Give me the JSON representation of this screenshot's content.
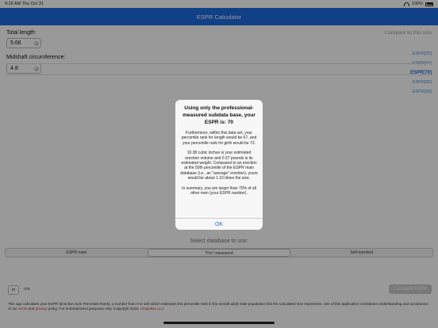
{
  "status": {
    "time": "4:26 AM  Thu Oct 31",
    "battery": "100%"
  },
  "nav": {
    "title": "ESPR Calculator"
  },
  "form": {
    "length_label": "Total length:",
    "length_value": "5.66",
    "girth_label": "Midshaft circumference:",
    "girth_value": "4.8"
  },
  "compare": {
    "label": "Compare to this size",
    "items": [
      "ESPR[25]",
      "ESPR[50]",
      "ESPR[70]",
      "ESPR[95]",
      "ESPR[99]"
    ],
    "selected_index": 2
  },
  "database": {
    "title": "Select database to use:",
    "options": [
      "ESPR main",
      "\"Pro\"-measured",
      "Self-reported"
    ],
    "selected_index": 1
  },
  "units": {
    "options": [
      "in",
      "cm"
    ],
    "selected_index": 0
  },
  "calculate_label": "Calculate ESPR",
  "footer": {
    "text1": "This app calculates your ESPR (Erection Size Percentile Rank), a number from 0 to 100 which estimates the percentile rank in the overall adult male population that the calculated size represents.  Use of this application constitutes understanding and acceptance of our ",
    "terms": "terms",
    "and": " and ",
    "privacy": "privacy",
    "text2": " policy.  For entertainment purposes only.  Copyright 2019, ",
    "company": "Unspoken LLC"
  },
  "alert": {
    "title": "Using only the professional-measured subdata base, your ESPR is: 70",
    "p1": "Furthermore, within this data set, your percentile rank for length would be 67, and your percentile rank for girth would be 72.",
    "p2": "10.38 cubic inches is your estimated erection volume and 0.37 pounds is its estimated weight.  Compared to an erection at the 50th percentile of the ESPR main database (i.e., an \"average\" erection), yours would be about 1.10 times the size.",
    "p3": "In summary, you are larger than 70% of all other men (your ESPR number).",
    "ok_label": "OK"
  }
}
